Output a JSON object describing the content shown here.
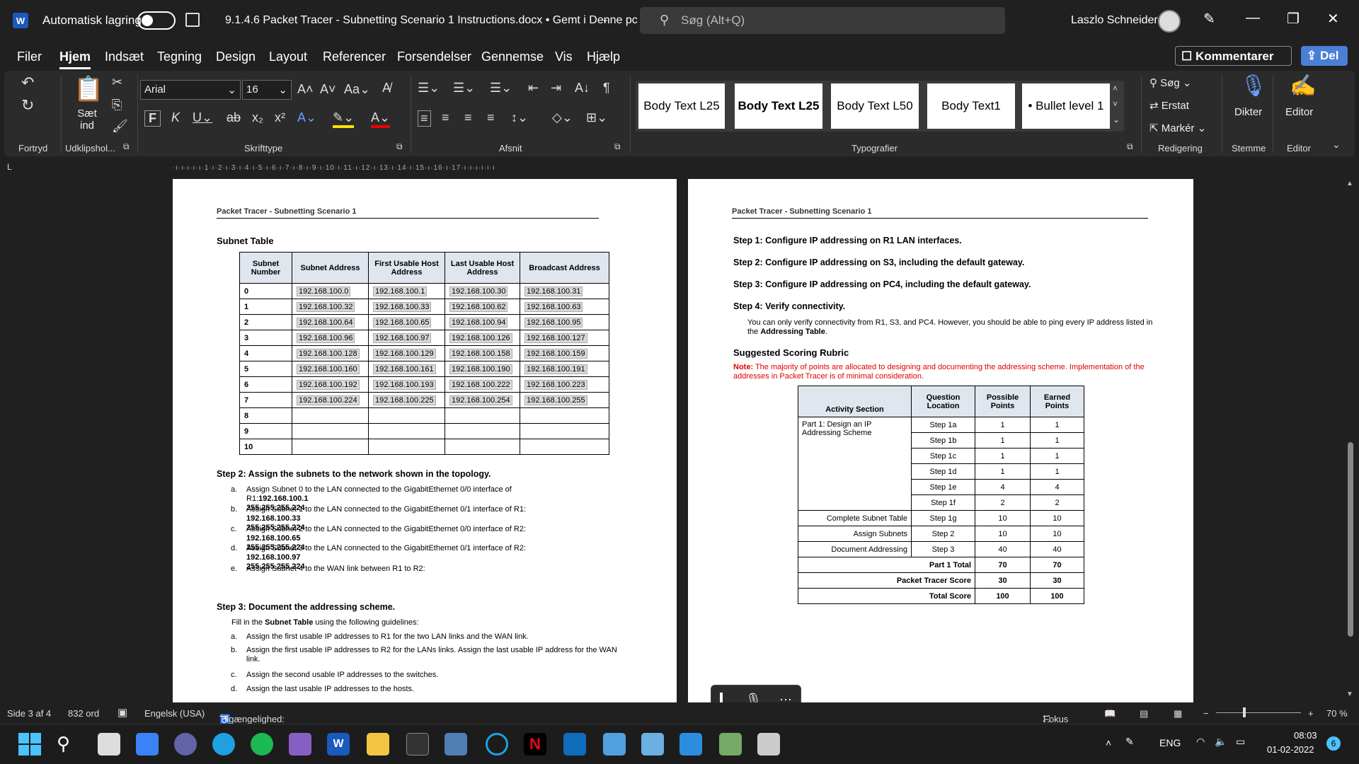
{
  "titlebar": {
    "autosave": "Automatisk lagring",
    "doc_title": "9.1.4.6 Packet Tracer - Subnetting Scenario 1 Instructions.docx • Gemt i Denne pc",
    "search": "Søg (Alt+Q)",
    "user": "Laszlo Schneider"
  },
  "menu": [
    "Filer",
    "Hjem",
    "Indsæt",
    "Tegning",
    "Design",
    "Layout",
    "Referencer",
    "Forsendelser",
    "Gennemse",
    "Vis",
    "Hjælp"
  ],
  "comments_btn": "Kommentarer",
  "share_btn": "Del",
  "ribbon": {
    "font": "Arial",
    "size": "16",
    "paste": "Sæt ind",
    "groups": [
      "Fortryd",
      "Udklipshol...",
      "Skrifttype",
      "Afsnit",
      "Typografier",
      "Redigering",
      "Stemme",
      "Editor"
    ],
    "styles": [
      "Body Text L25",
      "Body Text L25",
      "Body Text L50",
      "Body Text1",
      "• Bullet level 1"
    ],
    "search": "Søg",
    "replace": "Erstat",
    "select": "Markér",
    "dictate": "Dikter",
    "editor": "Editor"
  },
  "page1": {
    "header": "Packet Tracer - Subnetting Scenario 1",
    "subnet_title": "Subnet Table",
    "table_headers": [
      "Subnet Number",
      "Subnet Address",
      "First Usable Host Address",
      "Last Usable Host Address",
      "Broadcast Address"
    ],
    "rows": [
      [
        "0",
        "192.168.100.0",
        "192.168.100.1",
        "192.168.100.30",
        "192.168.100.31"
      ],
      [
        "1",
        "192.168.100.32",
        "192.168.100.33",
        "192.168.100.62",
        "192.168.100.63"
      ],
      [
        "2",
        "192.168.100.64",
        "192.168.100.65",
        "192.168.100.94",
        "192.168.100.95"
      ],
      [
        "3",
        "192.168.100.96",
        "192.168.100.97",
        "192.168.100.126",
        "192.168.100.127"
      ],
      [
        "4",
        "192.168.100.128",
        "192.168.100.129",
        "192.168.100.158",
        "192.168.100.159"
      ],
      [
        "5",
        "192.168.100.160",
        "192.168.100.161",
        "192.168.100.190",
        "192.168.100.191"
      ],
      [
        "6",
        "192.168.100.192",
        "192.168.100.193",
        "192.168.100.222",
        "192.168.100.223"
      ],
      [
        "7",
        "192.168.100.224",
        "192.168.100.225",
        "192.168.100.254",
        "192.168.100.255"
      ],
      [
        "8",
        "",
        "",
        "",
        ""
      ],
      [
        "9",
        "",
        "",
        "",
        ""
      ],
      [
        "10",
        "",
        "",
        "",
        ""
      ]
    ],
    "step2": "Step 2:   Assign the subnets to the network shown in the topology.",
    "step2_items": [
      {
        "m": "a.",
        "t": "Assign Subnet 0 to the LAN connected to the GigabitEthernet 0/0 interface of R1:",
        "b": "192.168.100.1",
        "b2": "255.255.255.224"
      },
      {
        "m": "b.",
        "t": "Assign Subnet 1 to the LAN connected to the GigabitEthernet 0/1 interface of R1: ",
        "b": "192.168.100.33",
        "b2": "255.255.255.224"
      },
      {
        "m": "c.",
        "t": "Assign Subnet 2 to the LAN connected to the GigabitEthernet 0/0 interface of R2: ",
        "b": "192.168.100.65",
        "b2": "255.255.255.224"
      },
      {
        "m": "d.",
        "t": "Assign Subnet 3 to the LAN connected to the GigabitEthernet 0/1 interface of R2: ",
        "b": "192.168.100.97",
        "b2": "255.255.255.224"
      },
      {
        "m": "e.",
        "t": "Assign Subnet 4 to the WAN link between R1 to R2:",
        "b": "",
        "b2": ""
      }
    ],
    "step3": "Step 3:   Document the addressing scheme.",
    "step3_intro_a": "Fill in the ",
    "step3_intro_b": "Subnet Table",
    "step3_intro_c": " using the following guidelines:",
    "step3_items": [
      {
        "m": "a.",
        "t": "Assign the first usable IP addresses to R1 for the two LAN links and the WAN link."
      },
      {
        "m": "b.",
        "t": "Assign the first usable IP addresses to R2 for the LANs links. Assign the last usable IP address for the WAN link."
      },
      {
        "m": "c.",
        "t": "Assign the second usable IP addresses to the switches."
      },
      {
        "m": "d.",
        "t": "Assign the last usable IP addresses to the hosts."
      }
    ]
  },
  "page2": {
    "header": "Packet Tracer - Subnetting Scenario 1",
    "steps": [
      "Step 1:   Configure IP addressing on R1 LAN interfaces.",
      "Step 2:   Configure IP addressing on S3, including the default gateway.",
      "Step 3:   Configure IP addressing on PC4, including the default gateway.",
      "Step 4:   Verify connectivity."
    ],
    "verify_a": "You can only verify connectivity from R1, S3, and PC4. However, you should be able to ping every IP address listed in the ",
    "verify_b": "Addressing Table",
    "verify_c": ".",
    "rubric_title": "Suggested Scoring Rubric",
    "note_a": "Note:",
    "note_b": " The majority of points are allocated to designing and documenting the addressing scheme. Implementation of the addresses in Packet Tracer is of minimal consideration.",
    "rubric_headers": [
      "Activity Section",
      "Question Location",
      "Possible Points",
      "Earned Points"
    ],
    "rubric_first": "Part 1: Design an IP Addressing Scheme",
    "rubric_rows": [
      [
        "",
        "Step 1a",
        "1",
        "1"
      ],
      [
        "",
        "Step 1b",
        "1",
        "1"
      ],
      [
        "",
        "Step 1c",
        "1",
        "1"
      ],
      [
        "",
        "Step 1d",
        "1",
        "1"
      ],
      [
        "",
        "Step 1e",
        "4",
        "4"
      ],
      [
        "",
        "Step 1f",
        "2",
        "2"
      ],
      [
        "Complete Subnet Table",
        "Step 1g",
        "10",
        "10"
      ],
      [
        "Assign Subnets",
        "Step 2",
        "10",
        "10"
      ],
      [
        "Document Addressing",
        "Step 3",
        "40",
        "40"
      ]
    ],
    "rubric_totals": [
      [
        "Part 1 Total",
        "70",
        "70"
      ],
      [
        "Packet Tracer Score",
        "30",
        "30"
      ],
      [
        "Total Score",
        "100",
        "100"
      ]
    ]
  },
  "status": {
    "page": "Side 3 af 4",
    "words": "832 ord",
    "lang": "Engelsk (USA)",
    "access": "Tilgængelighed: Undersøg",
    "focus": "Fokus",
    "zoom": "70 %"
  },
  "tray": {
    "lang": "ENG",
    "time": "08:03",
    "date": "01-02-2022",
    "badge": "6"
  }
}
